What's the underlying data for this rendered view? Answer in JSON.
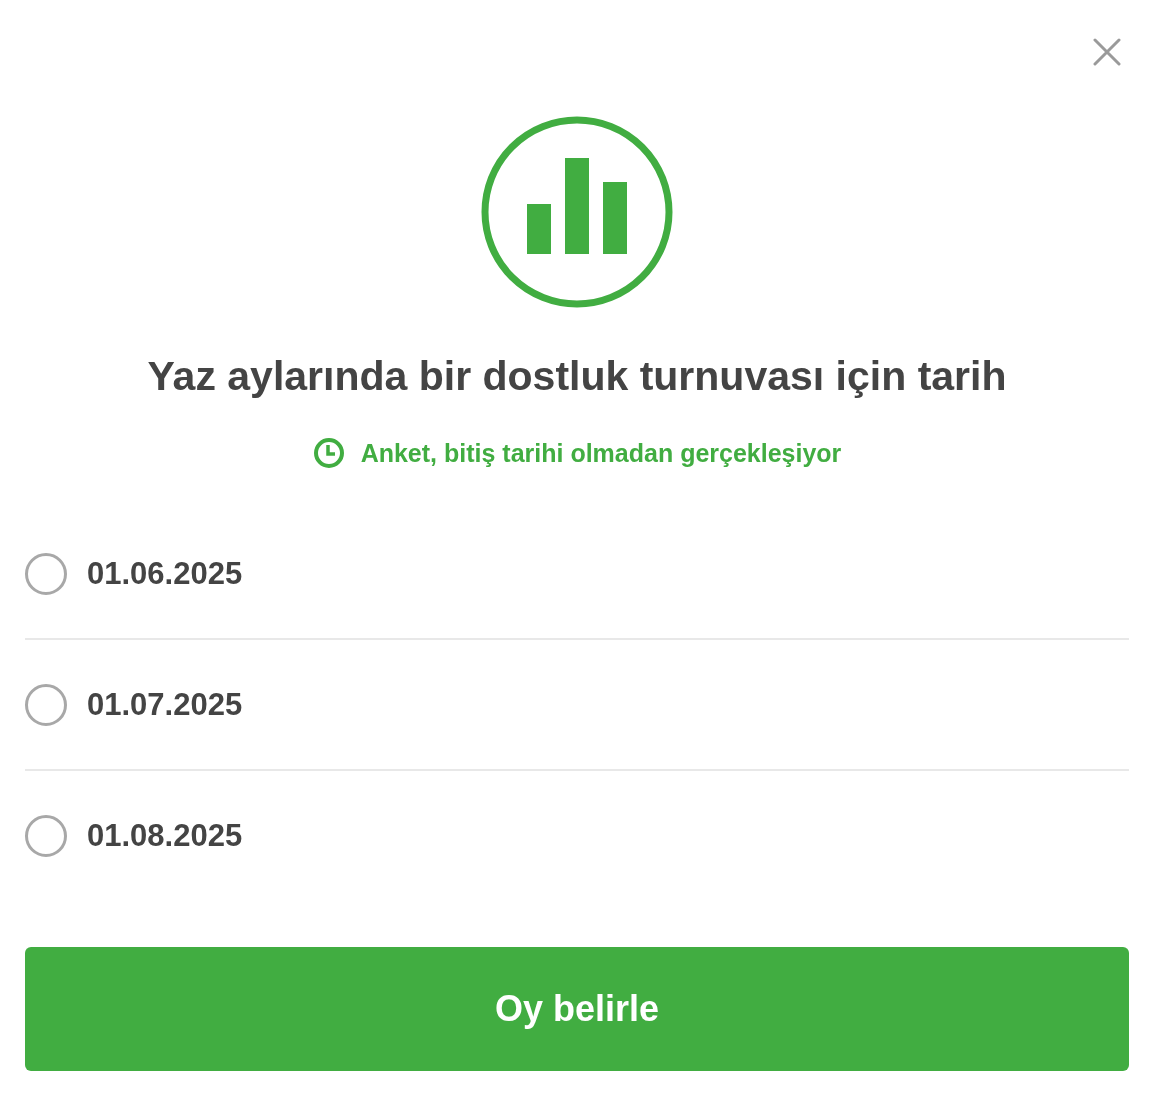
{
  "title": "Yaz aylarında bir dostluk turnuvası için tarih",
  "deadline": "Anket, bitiş tarihi olmadan gerçekleşiyor",
  "options": [
    {
      "label": "01.06.2025",
      "selected": false
    },
    {
      "label": "01.07.2025",
      "selected": false
    },
    {
      "label": "01.08.2025",
      "selected": false
    }
  ],
  "submit": "Oy belirle"
}
